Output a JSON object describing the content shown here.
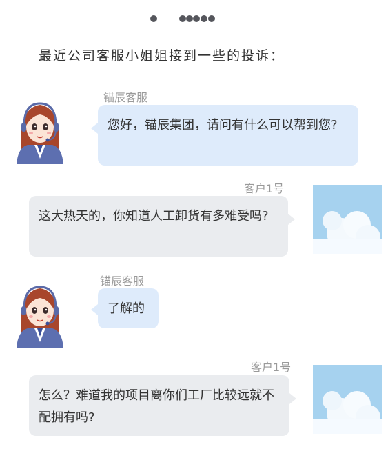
{
  "intro_text": "最近公司客服小姐姐接到一些的投诉：",
  "messages": [
    {
      "sender": "锚辰客服",
      "text": "您好，锚辰集团，请问有什么可以帮到您?"
    },
    {
      "sender": "客户1号",
      "text": "这大热天的，你知道人工卸货有多难受吗?"
    },
    {
      "sender": "锚辰客服",
      "text": "了解的"
    },
    {
      "sender": "客户1号",
      "text": "怎么？难道我的项目离你们工厂比较远就不配拥有吗?"
    }
  ],
  "colors": {
    "agent_bubble": "#deebfb",
    "customer_bubble": "#eaecef",
    "dots": "#55565c"
  },
  "icons": {
    "agent_avatar": "customer-service-girl-icon",
    "customer_avatar": "sky-cloud-photo"
  }
}
